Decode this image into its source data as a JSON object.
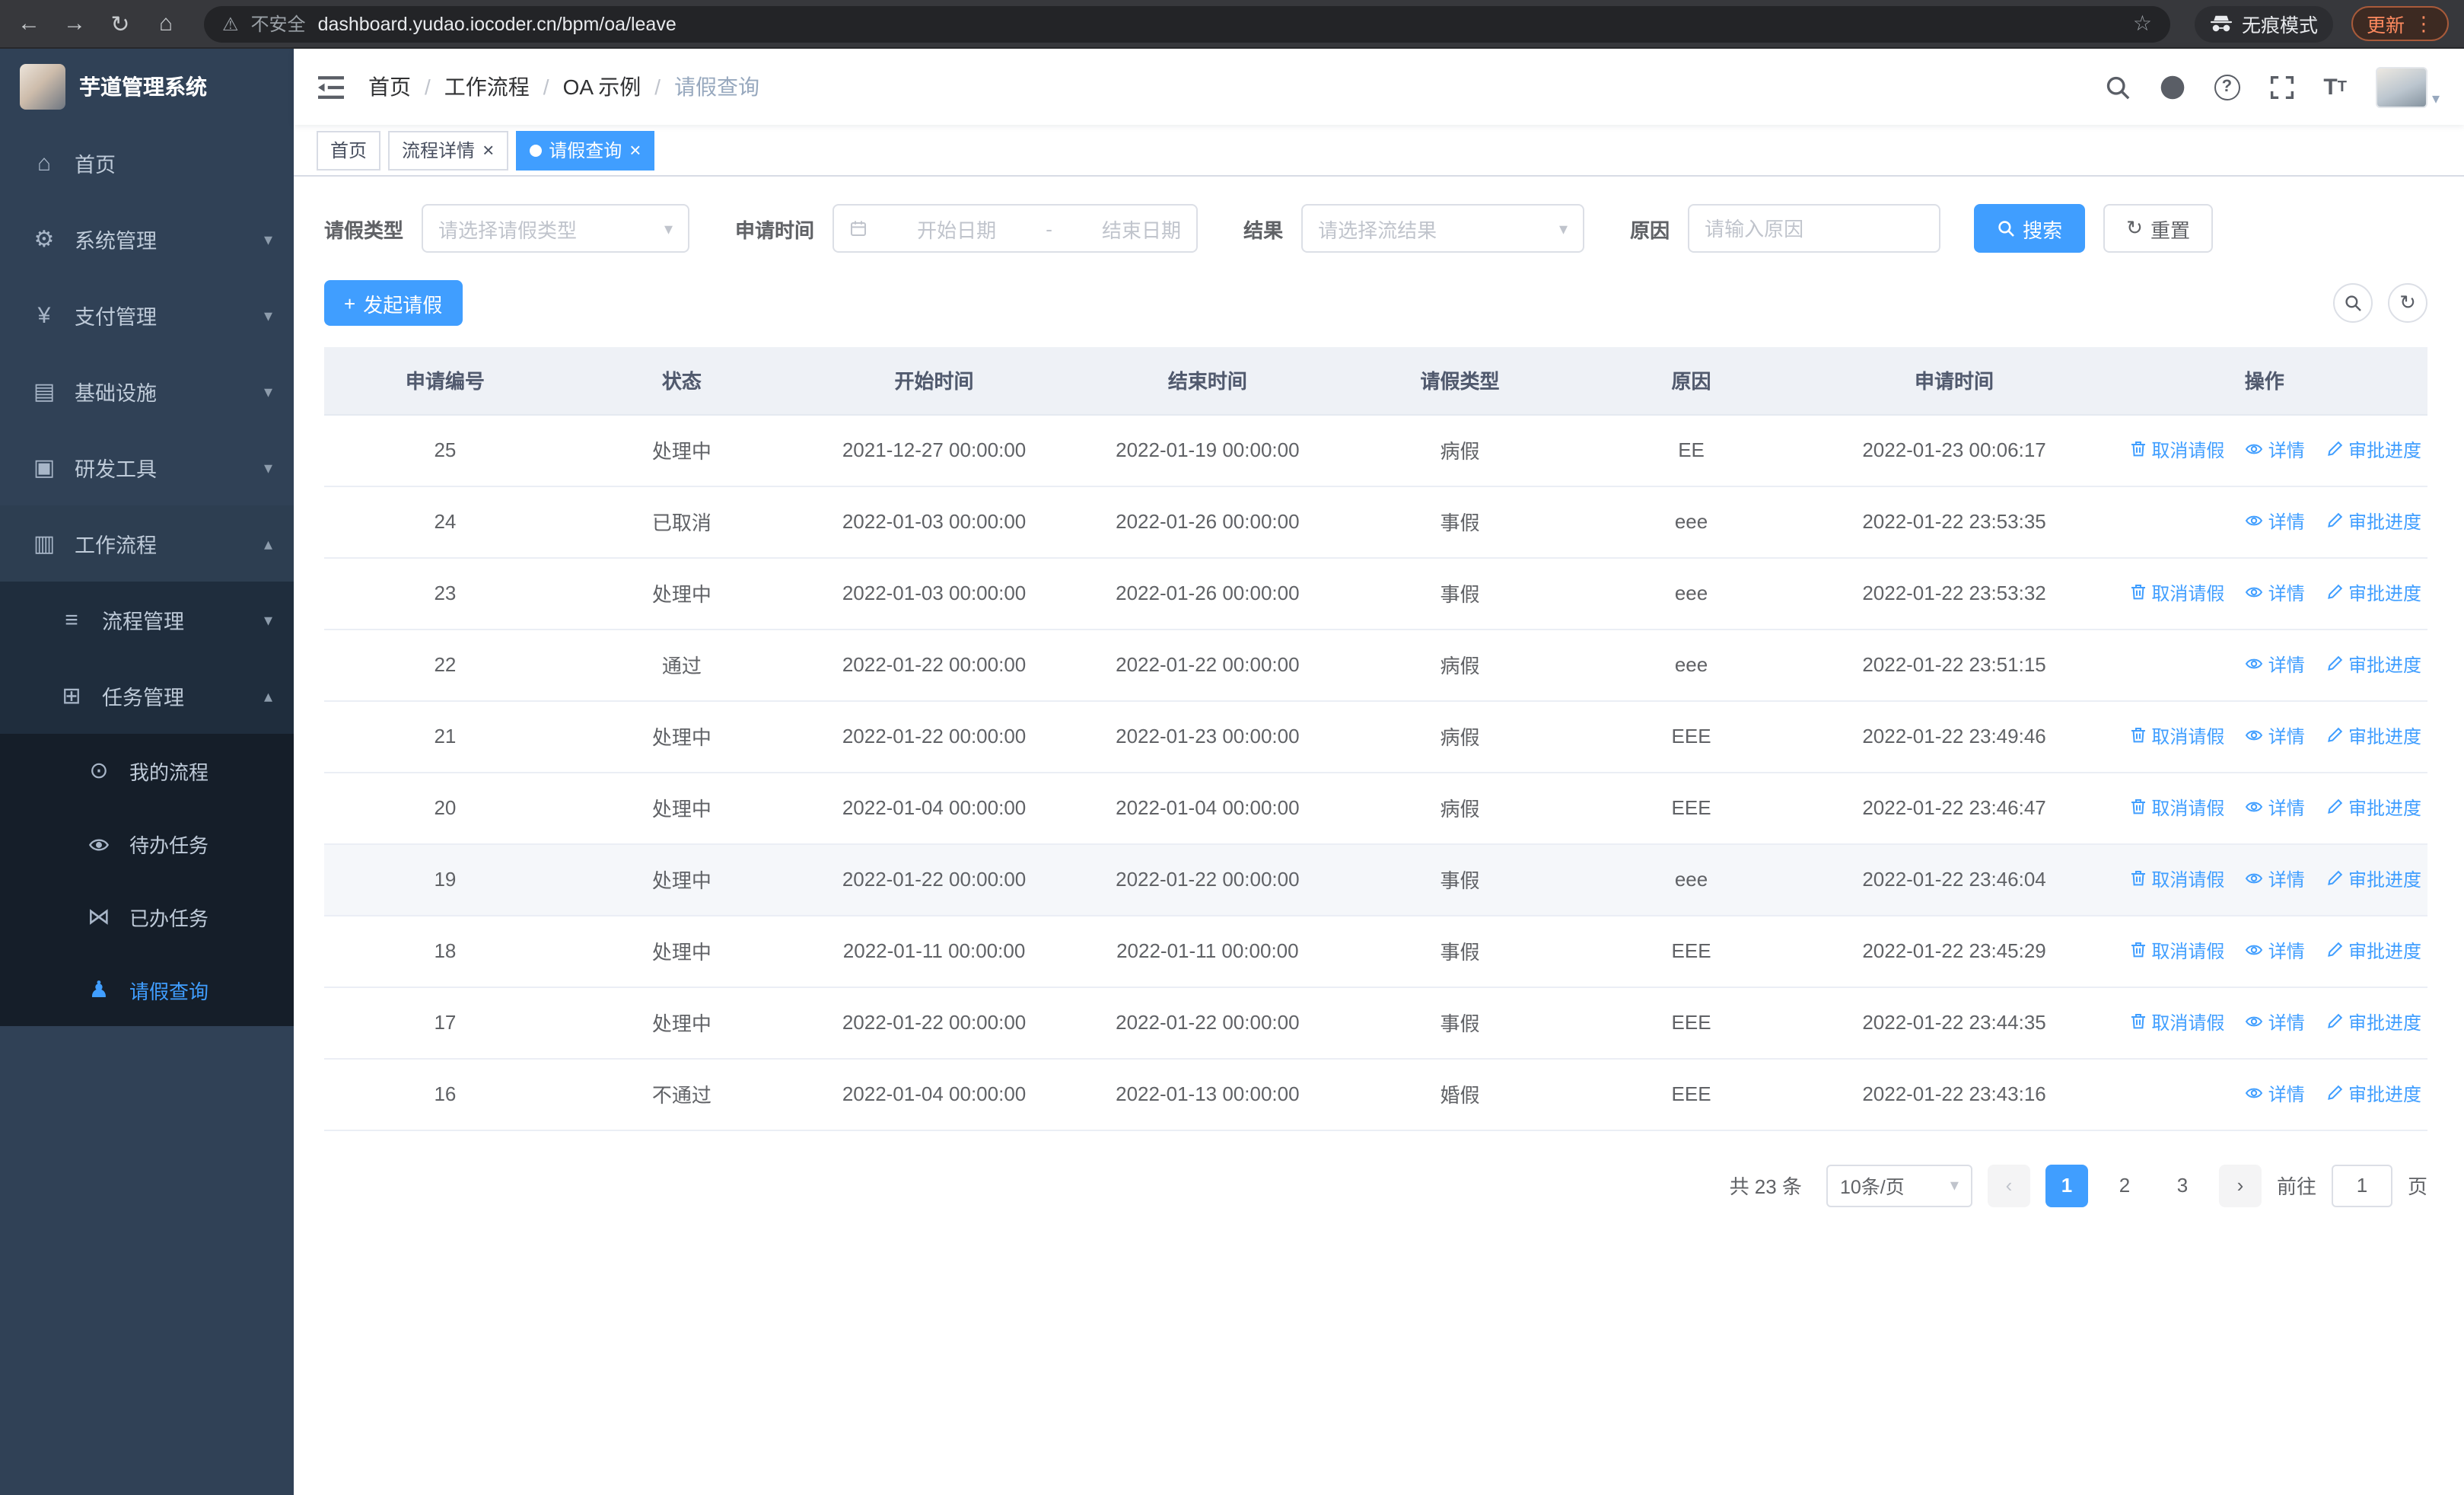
{
  "browser": {
    "security_label": "不安全",
    "url": "dashboard.yudao.iocoder.cn/bpm/oa/leave",
    "incognito_label": "无痕模式",
    "update_label": "更新"
  },
  "icons": {
    "back": "←",
    "forward": "→",
    "reload": "↻",
    "home": "⌂",
    "warning": "⚠",
    "star": "☆",
    "kebab": "⋮",
    "gear": "⚙",
    "yen": "¥",
    "infra": "▤",
    "tools": "▣",
    "workflow": "▥",
    "process": "≡",
    "task": "⊞",
    "chat": "⊙",
    "done": "⋈",
    "user": "♟",
    "chevron_down": "▾",
    "chevron_up": "▴",
    "close": "×",
    "plus": "+",
    "refresh": "↻",
    "prev": "‹",
    "next": "›",
    "help": "?",
    "font_large": "T",
    "font_small": "T",
    "caret_down": "▾"
  },
  "sidebar": {
    "app_title": "芋道管理系统",
    "menu": [
      {
        "label": "首页",
        "icon": "home-icon"
      },
      {
        "label": "系统管理",
        "icon": "gear-icon",
        "collapsed": true
      },
      {
        "label": "支付管理",
        "icon": "yen-icon",
        "collapsed": true
      },
      {
        "label": "基础设施",
        "icon": "monitor-icon",
        "collapsed": true
      },
      {
        "label": "研发工具",
        "icon": "toolbox-icon",
        "collapsed": true
      },
      {
        "label": "工作流程",
        "icon": "briefcase-icon",
        "open": true
      },
      {
        "label": "流程管理",
        "icon": "process-list-icon",
        "collapsed": true
      },
      {
        "label": "任务管理",
        "icon": "task-grid-icon",
        "open": true
      },
      {
        "label": "我的流程",
        "icon": "chat-icon"
      },
      {
        "label": "待办任务",
        "icon": "eye-icon"
      },
      {
        "label": "已办任务",
        "icon": "bowtie-icon"
      },
      {
        "label": "请假查询",
        "icon": "user-icon",
        "active": true
      }
    ]
  },
  "header": {
    "breadcrumb": [
      "首页",
      "工作流程",
      "OA 示例",
      "请假查询"
    ]
  },
  "tabs": [
    {
      "label": "首页",
      "closable": false,
      "active": false
    },
    {
      "label": "流程详情",
      "closable": true,
      "active": false
    },
    {
      "label": "请假查询",
      "closable": true,
      "active": true
    }
  ],
  "filters": {
    "type_label": "请假类型",
    "type_placeholder": "请选择请假类型",
    "time_label": "申请时间",
    "start_placeholder": "开始日期",
    "range_separator": "-",
    "end_placeholder": "结束日期",
    "result_label": "结果",
    "result_placeholder": "请选择流结果",
    "reason_label": "原因",
    "reason_placeholder": "请输入原因",
    "search_label": "搜索",
    "reset_label": "重置"
  },
  "toolbar": {
    "create_label": "发起请假"
  },
  "table": {
    "columns": [
      "申请编号",
      "状态",
      "开始时间",
      "结束时间",
      "请假类型",
      "原因",
      "申请时间",
      "操作"
    ],
    "action_labels": {
      "cancel": "取消请假",
      "detail": "详情",
      "progress": "审批进度"
    },
    "rows": [
      {
        "id": "25",
        "status": "处理中",
        "start": "2021-12-27 00:00:00",
        "end": "2022-01-19 00:00:00",
        "type": "病假",
        "reason": "EE",
        "applied": "2022-01-23 00:06:17",
        "can_cancel": true,
        "hovered": false
      },
      {
        "id": "24",
        "status": "已取消",
        "start": "2022-01-03 00:00:00",
        "end": "2022-01-26 00:00:00",
        "type": "事假",
        "reason": "eee",
        "applied": "2022-01-22 23:53:35",
        "can_cancel": false,
        "hovered": false
      },
      {
        "id": "23",
        "status": "处理中",
        "start": "2022-01-03 00:00:00",
        "end": "2022-01-26 00:00:00",
        "type": "事假",
        "reason": "eee",
        "applied": "2022-01-22 23:53:32",
        "can_cancel": true,
        "hovered": false
      },
      {
        "id": "22",
        "status": "通过",
        "start": "2022-01-22 00:00:00",
        "end": "2022-01-22 00:00:00",
        "type": "病假",
        "reason": "eee",
        "applied": "2022-01-22 23:51:15",
        "can_cancel": false,
        "hovered": false
      },
      {
        "id": "21",
        "status": "处理中",
        "start": "2022-01-22 00:00:00",
        "end": "2022-01-23 00:00:00",
        "type": "病假",
        "reason": "EEE",
        "applied": "2022-01-22 23:49:46",
        "can_cancel": true,
        "hovered": false
      },
      {
        "id": "20",
        "status": "处理中",
        "start": "2022-01-04 00:00:00",
        "end": "2022-01-04 00:00:00",
        "type": "病假",
        "reason": "EEE",
        "applied": "2022-01-22 23:46:47",
        "can_cancel": true,
        "hovered": false
      },
      {
        "id": "19",
        "status": "处理中",
        "start": "2022-01-22 00:00:00",
        "end": "2022-01-22 00:00:00",
        "type": "事假",
        "reason": "eee",
        "applied": "2022-01-22 23:46:04",
        "can_cancel": true,
        "hovered": true
      },
      {
        "id": "18",
        "status": "处理中",
        "start": "2022-01-11 00:00:00",
        "end": "2022-01-11 00:00:00",
        "type": "事假",
        "reason": "EEE",
        "applied": "2022-01-22 23:45:29",
        "can_cancel": true,
        "hovered": false
      },
      {
        "id": "17",
        "status": "处理中",
        "start": "2022-01-22 00:00:00",
        "end": "2022-01-22 00:00:00",
        "type": "事假",
        "reason": "EEE",
        "applied": "2022-01-22 23:44:35",
        "can_cancel": true,
        "hovered": false
      },
      {
        "id": "16",
        "status": "不通过",
        "start": "2022-01-04 00:00:00",
        "end": "2022-01-13 00:00:00",
        "type": "婚假",
        "reason": "EEE",
        "applied": "2022-01-22 23:43:16",
        "can_cancel": false,
        "hovered": false
      }
    ]
  },
  "pagination": {
    "total_label": "共 23 条",
    "page_size": "10条/页",
    "pages": [
      "1",
      "2",
      "3"
    ],
    "active_page": "1",
    "goto_label": "前往",
    "goto_value": "1",
    "page_label": "页"
  }
}
